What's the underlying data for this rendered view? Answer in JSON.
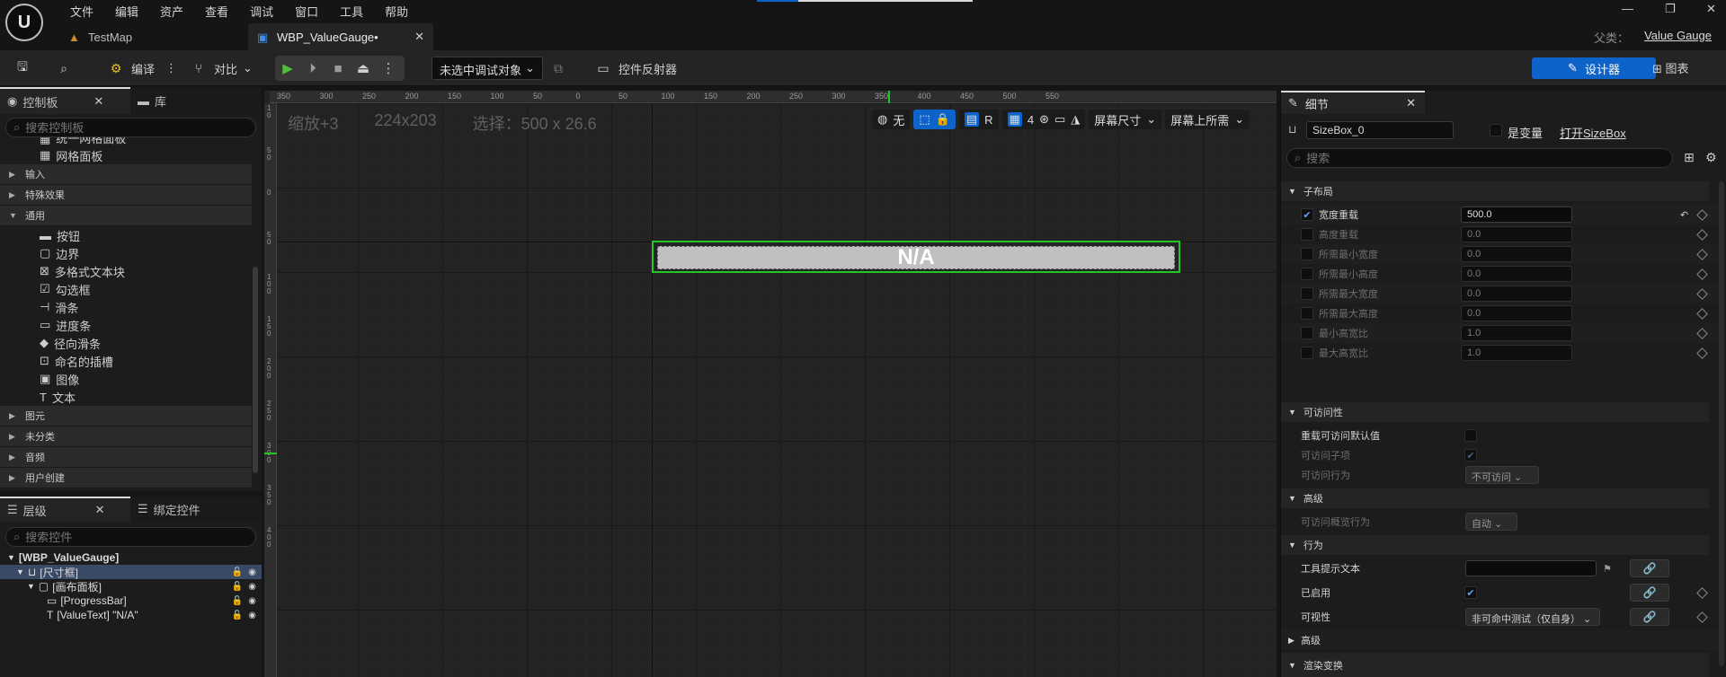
{
  "menu": [
    "文件",
    "编辑",
    "资产",
    "查看",
    "调试",
    "窗口",
    "工具",
    "帮助"
  ],
  "title_progress": 0.19,
  "tabs": [
    {
      "label": "TestMap"
    },
    {
      "label": "WBP_ValueGauge•"
    }
  ],
  "parent": {
    "label": "父类：",
    "value": "Value Gauge"
  },
  "toolbar": {
    "compile": "编译",
    "diff": "对比",
    "debug_target": "未选中调试对象",
    "reflector": "控件反射器",
    "designer": "设计器",
    "graph": "图表"
  },
  "palette": {
    "tab_label": "控制板",
    "lib_label": "库",
    "search_placeholder": "搜索控制板",
    "top_items": [
      "统一网格面板",
      "网格面板"
    ],
    "categories_before": [
      "输入",
      "特殊效果"
    ],
    "open_category": "通用",
    "common_items": [
      "按钮",
      "边界",
      "多格式文本块",
      "勾选框",
      "滑条",
      "进度条",
      "径向滑条",
      "命名的插槽",
      "图像",
      "文本"
    ],
    "categories_after": [
      "图元",
      "未分类",
      "音频",
      "用户创建"
    ]
  },
  "hierarchy": {
    "tab_label": "层级",
    "bind_tab_label": "绑定控件",
    "search_placeholder": "搜索控件",
    "root": "[WBP_ValueGauge]",
    "nodes": [
      "[尺寸框]",
      "[画布面板]",
      "[ProgressBar]",
      "[ValueText] \"N/A\""
    ]
  },
  "canvas": {
    "zoom": "缩放+3",
    "size": "224x203",
    "selection": "选择：500 x 26.6",
    "ruler_top": [
      "350",
      "300",
      "250",
      "200",
      "150",
      "100",
      "50",
      "0",
      "50",
      "100",
      "150",
      "200",
      "250",
      "300",
      "350",
      "400",
      "450",
      "500",
      "550"
    ],
    "ruler_left": [
      "1 0",
      "5 0",
      "0",
      "5 0",
      "1 0 0",
      "1 5 0",
      "2 0 0",
      "2 5 0",
      "3 0 0",
      "3 5 0",
      "4 0 0"
    ],
    "tools": {
      "world": "无",
      "r": "R",
      "grid": "4",
      "screen_size": "屏幕尺寸",
      "fill": "屏幕上所需"
    },
    "widget_text": "N/A"
  },
  "details": {
    "tab_label": "细节",
    "name": "SizeBox_0",
    "is_variable": "是变量",
    "open_link": "打开SizeBox",
    "search_placeholder": "搜索",
    "sections": {
      "child_layout": "子布局",
      "accessibility": "可访问性",
      "advanced": "高级",
      "behavior": "行为",
      "advanced2": "高级",
      "render_transform": "渲染变换"
    },
    "layout_rows": [
      {
        "label": "宽度重载",
        "value": "500.0",
        "checked": true
      },
      {
        "label": "高度重载",
        "value": "0.0",
        "checked": false
      },
      {
        "label": "所需最小宽度",
        "value": "0.0",
        "checked": false
      },
      {
        "label": "所需最小高度",
        "value": "0.0",
        "checked": false
      },
      {
        "label": "所需最大宽度",
        "value": "0.0",
        "checked": false
      },
      {
        "label": "所需最大高度",
        "value": "0.0",
        "checked": false
      },
      {
        "label": "最小高宽比",
        "value": "1.0",
        "checked": false
      },
      {
        "label": "最大高宽比",
        "value": "1.0",
        "checked": false
      }
    ],
    "access_rows": {
      "override": "重载可访问默认值",
      "children": "可访问子项",
      "behavior": "可访问行为",
      "behavior_value": "不可访问",
      "summary": "可访问概览行为",
      "summary_value": "自动"
    },
    "behavior_rows": {
      "tooltip": "工具提示文本",
      "enabled": "已启用",
      "visibility": "可视性",
      "visibility_value": "非可命中测试（仅自身）"
    }
  }
}
